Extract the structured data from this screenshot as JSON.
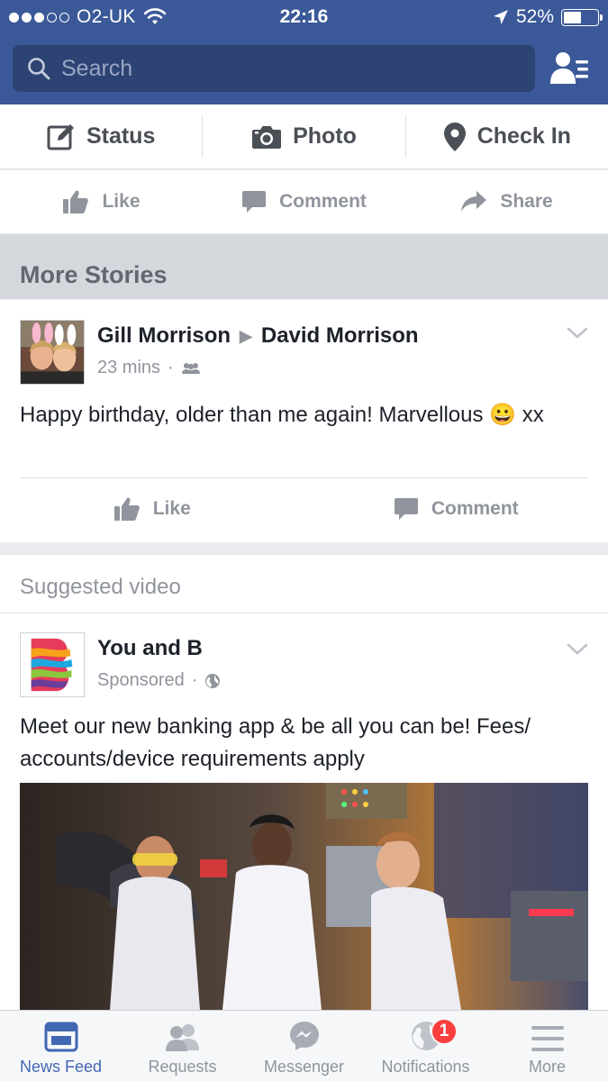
{
  "status_bar": {
    "carrier": "O2-UK",
    "signal_bars_filled": 3,
    "signal_bars_total": 5,
    "time": "22:16",
    "battery_percent": "52%",
    "battery_level": 0.52
  },
  "search": {
    "placeholder": "Search"
  },
  "composer": {
    "status_label": "Status",
    "photo_label": "Photo",
    "checkin_label": "Check In"
  },
  "prev_post_actions": {
    "like_label": "Like",
    "comment_label": "Comment",
    "share_label": "Share"
  },
  "more_stories": {
    "title": "More Stories"
  },
  "story_post": {
    "author": "Gill Morrison",
    "target": "David Morrison",
    "time": "23 mins",
    "privacy_icon": "friends-icon",
    "text": "Happy birthday, older than me again! Marvellous 😀 xx",
    "like_label": "Like",
    "comment_label": "Comment"
  },
  "suggested": {
    "label": "Suggested video",
    "page_name": "You and B",
    "sponsored_label": "Sponsored",
    "privacy_icon": "globe-icon",
    "text": "Meet our new banking app & be all you can be! Fees/ accounts/device requirements apply"
  },
  "tabbar": {
    "tabs": [
      {
        "label": "News Feed",
        "icon": "news-feed-icon",
        "active": true
      },
      {
        "label": "Requests",
        "icon": "requests-icon",
        "active": false
      },
      {
        "label": "Messenger",
        "icon": "messenger-icon",
        "active": false
      },
      {
        "label": "Notifications",
        "icon": "notifications-globe-icon",
        "active": false
      },
      {
        "label": "More",
        "icon": "menu-icon",
        "active": false
      }
    ],
    "notifications_badge": "1"
  },
  "colors": {
    "brand_blue": "#3b5998",
    "active_tab": "#4267b2",
    "badge_red": "#fa3e3e"
  }
}
